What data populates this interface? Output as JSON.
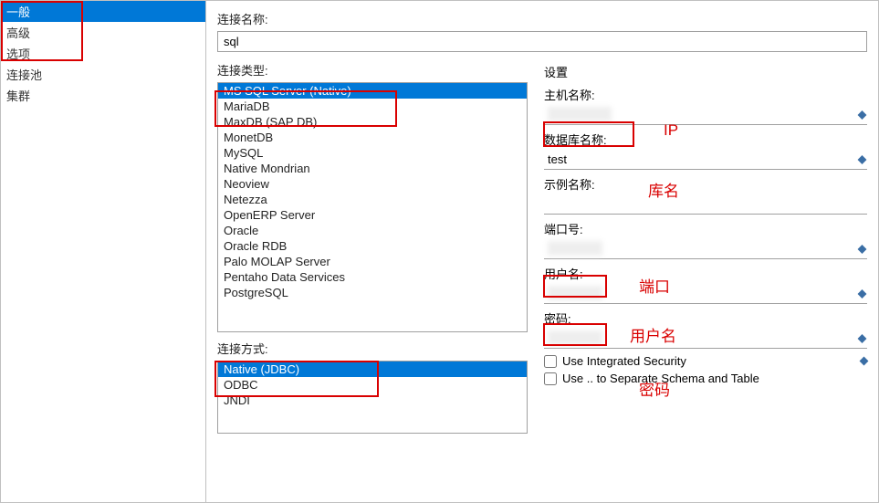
{
  "sidebar": {
    "items": [
      {
        "label": "一般",
        "selected": true
      },
      {
        "label": "高级",
        "selected": false
      },
      {
        "label": "选项",
        "selected": false
      },
      {
        "label": "连接池",
        "selected": false
      },
      {
        "label": "集群",
        "selected": false
      }
    ]
  },
  "connection_name": {
    "label": "连接名称:",
    "value": "sql"
  },
  "connection_type": {
    "label": "连接类型:",
    "options": [
      {
        "label": "MS SQL Server (Native)",
        "selected": true
      },
      {
        "label": "MariaDB"
      },
      {
        "label": "MaxDB (SAP DB)"
      },
      {
        "label": "MonetDB"
      },
      {
        "label": "MySQL"
      },
      {
        "label": "Native Mondrian"
      },
      {
        "label": "Neoview"
      },
      {
        "label": "Netezza"
      },
      {
        "label": "OpenERP Server"
      },
      {
        "label": "Oracle"
      },
      {
        "label": "Oracle RDB"
      },
      {
        "label": "Palo MOLAP Server"
      },
      {
        "label": "Pentaho Data Services"
      },
      {
        "label": "PostgreSQL"
      }
    ]
  },
  "access_type": {
    "label": "连接方式:",
    "options": [
      {
        "label": "Native (JDBC)",
        "selected": true
      },
      {
        "label": "ODBC"
      },
      {
        "label": "JNDI"
      }
    ]
  },
  "settings": {
    "title": "设置",
    "host": {
      "label": "主机名称:",
      "value": ""
    },
    "dbname": {
      "label": "数据库名称:",
      "value": "test"
    },
    "instance": {
      "label": "示例名称:",
      "value": ""
    },
    "port": {
      "label": "端口号:",
      "value": ""
    },
    "username": {
      "label": "用户名:",
      "value": ""
    },
    "password": {
      "label": "密码:",
      "value": ""
    },
    "integrated_security": {
      "label": "Use Integrated Security",
      "checked": false
    },
    "separate_schema": {
      "label": "Use .. to Separate Schema and Table",
      "checked": false
    }
  },
  "annotations": {
    "ip": "IP",
    "dbname": "库名",
    "port": "端口",
    "username": "用户名",
    "password": "密码"
  }
}
